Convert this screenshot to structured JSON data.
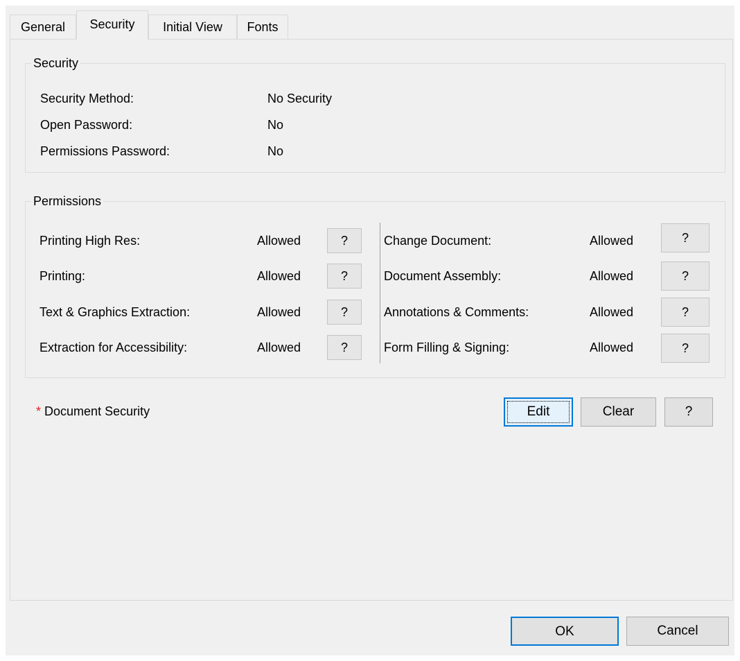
{
  "tabs": [
    {
      "label": "General"
    },
    {
      "label": "Security",
      "active": true
    },
    {
      "label": "Initial View"
    },
    {
      "label": "Fonts"
    }
  ],
  "security": {
    "legend": "Security",
    "rows": [
      {
        "label": "Security Method:",
        "value": "No Security"
      },
      {
        "label": "Open Password:",
        "value": "No"
      },
      {
        "label": "Permissions Password:",
        "value": "No"
      }
    ]
  },
  "permissions": {
    "legend": "Permissions",
    "left": [
      {
        "label": "Printing High Res:",
        "value": "Allowed",
        "help": "?"
      },
      {
        "label": "Printing:",
        "value": "Allowed",
        "help": "?"
      },
      {
        "label": "Text & Graphics Extraction:",
        "value": "Allowed",
        "help": "?"
      },
      {
        "label": "Extraction for Accessibility:",
        "value": "Allowed",
        "help": "?"
      }
    ],
    "right": [
      {
        "label": "Change Document:",
        "value": "Allowed",
        "help": "?"
      },
      {
        "label": "Document Assembly:",
        "value": "Allowed",
        "help": "?"
      },
      {
        "label": "Annotations & Comments:",
        "value": "Allowed",
        "help": "?"
      },
      {
        "label": "Form Filling & Signing:",
        "value": "Allowed",
        "help": "?"
      }
    ]
  },
  "doc_security": {
    "marker": "*",
    "label": "Document Security",
    "edit": "Edit",
    "clear": "Clear",
    "help": "?"
  },
  "footer": {
    "ok": "OK",
    "cancel": "Cancel"
  },
  "colors": {
    "required_marker": "#e02020",
    "focus_border": "#0078d7"
  }
}
